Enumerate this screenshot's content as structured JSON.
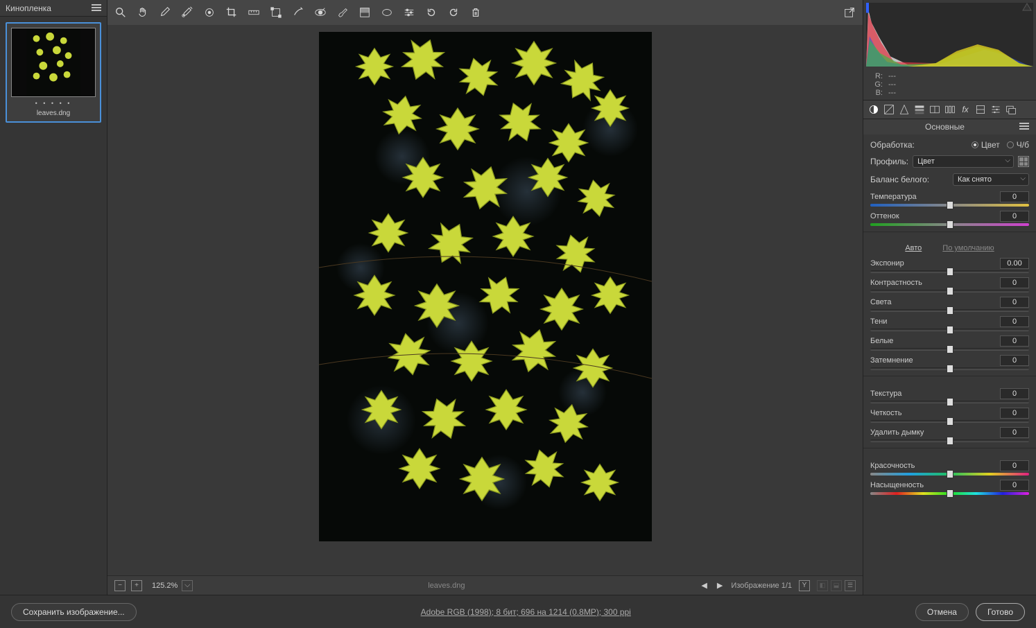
{
  "filmstrip": {
    "title": "Кинопленка",
    "thumb_name": "leaves.dng"
  },
  "viewer": {
    "zoom": "125.2%",
    "filename": "leaves.dng",
    "nav_label": "Изображение 1/1",
    "before_after_key": "Y"
  },
  "rgb": {
    "r_label": "R:",
    "g_label": "G:",
    "b_label": "B:",
    "r": "---",
    "g": "---",
    "b": "---"
  },
  "panel_title": "Основные",
  "basic": {
    "treatment_label": "Обработка:",
    "color_label": "Цвет",
    "bw_label": "Ч/б",
    "profile_label": "Профиль:",
    "profile_value": "Цвет",
    "wb_label": "Баланс белого:",
    "wb_value": "Как снято",
    "auto": "Авто",
    "default": "По умолчанию"
  },
  "sliders": {
    "temperature": {
      "label": "Температура",
      "value": "0"
    },
    "tint": {
      "label": "Оттенок",
      "value": "0"
    },
    "exposure": {
      "label": "Экспонир",
      "value": "0.00"
    },
    "contrast": {
      "label": "Контрастность",
      "value": "0"
    },
    "highlights": {
      "label": "Света",
      "value": "0"
    },
    "shadows": {
      "label": "Тени",
      "value": "0"
    },
    "whites": {
      "label": "Белые",
      "value": "0"
    },
    "blacks": {
      "label": "Затемнение",
      "value": "0"
    },
    "texture": {
      "label": "Текстура",
      "value": "0"
    },
    "clarity": {
      "label": "Четкость",
      "value": "0"
    },
    "dehaze": {
      "label": "Удалить дымку",
      "value": "0"
    },
    "vibrance": {
      "label": "Красочность",
      "value": "0"
    },
    "saturation": {
      "label": "Насыщенность",
      "value": "0"
    }
  },
  "bottom": {
    "save": "Сохранить изображение...",
    "meta": "Adobe RGB (1998); 8 бит; 696 на 1214 (0.8MP); 300 ppi",
    "cancel": "Отмена",
    "done": "Готово"
  }
}
